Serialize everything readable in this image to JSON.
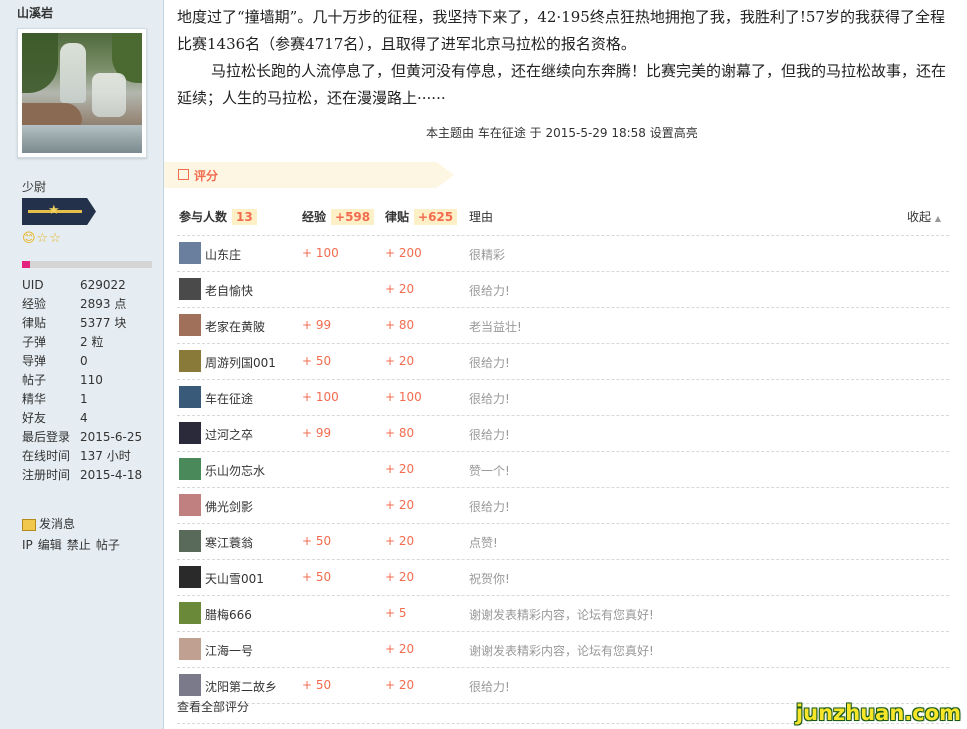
{
  "user": {
    "name": "山溪岩",
    "rank": "少尉",
    "stars": "😊☆☆",
    "progress_fraction": 0.06,
    "stats": [
      {
        "label": "UID",
        "value": "629022"
      },
      {
        "label": "经验",
        "value": "2893 点"
      },
      {
        "label": "律贴",
        "value": "5377 块"
      },
      {
        "label": "子弹",
        "value": "2 粒"
      },
      {
        "label": "导弹",
        "value": "0"
      },
      {
        "label": "帖子",
        "value": "110"
      },
      {
        "label": "精华",
        "value": "1"
      },
      {
        "label": "好友",
        "value": "4"
      },
      {
        "label": "最后登录",
        "value": "2015-6-25"
      },
      {
        "label": "在线时间",
        "value": "137 小时"
      },
      {
        "label": "注册时间",
        "value": "2015-4-18"
      }
    ],
    "send_message": "发消息",
    "admin_links": [
      "IP",
      "编辑",
      "禁止",
      "帖子"
    ]
  },
  "article": {
    "paragraph1": "地度过了“撞墙期”。几十万步的征程，我坚持下来了，42·195终点狂热地拥抱了我，我胜利了!57岁的我获得了全程比赛1436名（参赛4717名），且取得了进军北京马拉松的报名资格。",
    "paragraph2": "马拉松长跑的人流停息了，但黄河没有停息，还在继续向东奔腾！比赛完美的谢幕了，但我的马拉松故事，还在延续；人生的马拉松，还在漫漫路上······",
    "highlight_note": "本主题由 车在征途 于 2015-5-29 18:58 设置高亮"
  },
  "rating": {
    "section_title": "评分",
    "participants_label": "参与人数",
    "participants_count": "13",
    "exp_label": "经验",
    "exp_total": "+598",
    "post_label": "律贴",
    "post_total": "+625",
    "reason_label": "理由",
    "collapse_label": "收起",
    "rows": [
      {
        "user": "山东庄",
        "exp": "+ 100",
        "post": "+ 200",
        "reason": "很精彩",
        "avatar_color": "#6a7f9e"
      },
      {
        "user": "老自愉快",
        "exp": "",
        "post": "+ 20",
        "reason": "很给力!",
        "avatar_color": "#4a4a4a"
      },
      {
        "user": "老家在黄陂",
        "exp": "+ 99",
        "post": "+ 80",
        "reason": "老当益壮!",
        "avatar_color": "#a0705a"
      },
      {
        "user": "周游列国001",
        "exp": "+ 50",
        "post": "+ 20",
        "reason": "很给力!",
        "avatar_color": "#8a7a3a"
      },
      {
        "user": "车在征途",
        "exp": "+ 100",
        "post": "+ 100",
        "reason": "很给力!",
        "avatar_color": "#3a5a7a"
      },
      {
        "user": "过河之卒",
        "exp": "+ 99",
        "post": "+ 80",
        "reason": "很给力!",
        "avatar_color": "#2a2a3a"
      },
      {
        "user": "乐山勿忘水",
        "exp": "",
        "post": "+ 20",
        "reason": "赞一个!",
        "avatar_color": "#4a8a5a"
      },
      {
        "user": "佛光剑影",
        "exp": "",
        "post": "+ 20",
        "reason": "很给力!",
        "avatar_color": "#c08080"
      },
      {
        "user": "寒江蓑翁",
        "exp": "+ 50",
        "post": "+ 20",
        "reason": "点赞!",
        "avatar_color": "#5a6a5a"
      },
      {
        "user": "天山雪001",
        "exp": "+ 50",
        "post": "+ 20",
        "reason": "祝贺你!",
        "avatar_color": "#2a2a2a"
      },
      {
        "user": "腊梅666",
        "exp": "",
        "post": "+ 5",
        "reason": "谢谢发表精彩内容，论坛有您真好!",
        "avatar_color": "#6a8a3a"
      },
      {
        "user": "江海一号",
        "exp": "",
        "post": "+ 20",
        "reason": "谢谢发表精彩内容，论坛有您真好!",
        "avatar_color": "#c0a090"
      },
      {
        "user": "沈阳第二故乡",
        "exp": "+ 50",
        "post": "+ 20",
        "reason": "很给力!",
        "avatar_color": "#7a7a8a"
      }
    ],
    "view_all": "查看全部评分"
  },
  "watermark": "junzhuan.com"
}
